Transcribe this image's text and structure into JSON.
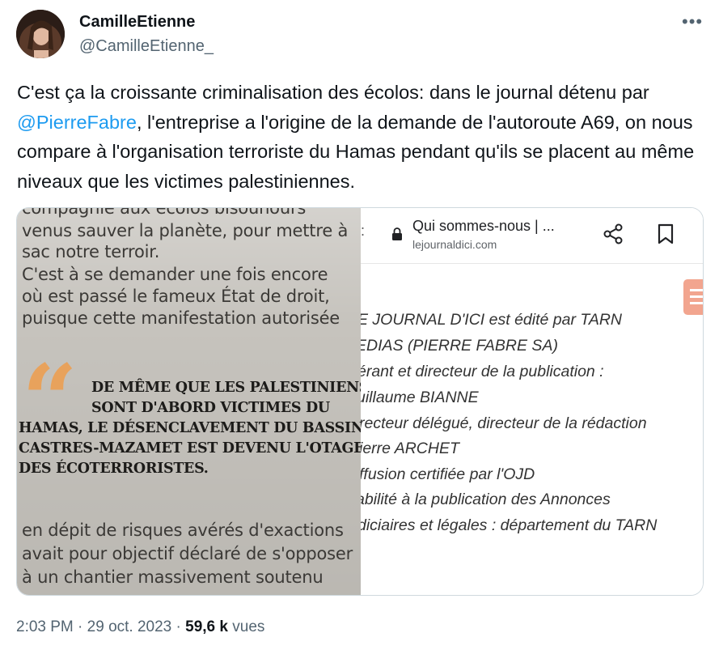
{
  "author": {
    "display_name": "CamilleEtienne",
    "handle": "@CamilleEtienne_"
  },
  "more_icon": "ellipsis-icon",
  "tweet": {
    "text_before_mention": "C'est ça la croissante criminalisation des écolos: dans le journal détenu par ",
    "mention": "@PierreFabre",
    "text_after_mention": ", l'entreprise a l'origine de la demande de l'autoroute A69, on nous compare à l'organisation terroriste du Hamas pendant qu'ils se placent au même niveaux que les victimes palestiniennes."
  },
  "media": {
    "newspaper": {
      "lines": [
        "compagnie aux écolos bisounours",
        "venus sauver la planète, pour mettre à",
        "sac notre terroir.",
        "C'est à se demander une fois encore",
        "où est passé le fameux État de droit,",
        "puisque cette manifestation autorisée"
      ],
      "quote_mark": "“",
      "quote_lines": [
        "DE MÊME QUE LES PALESTINIENS",
        "SONT D'ABORD VICTIMES DU",
        "HAMAS, LE DÉSENCLAVEMENT DU BASSIN",
        "CASTRES-MAZAMET EST DEVENU L'OTAGE",
        "DES ÉCOTERRORISTES."
      ],
      "bottom_lines": [
        "en dépit de risques avérés d'exactions",
        "avait pour objectif déclaré de s'opposer",
        "à un chantier massivement soutenu"
      ]
    },
    "browser": {
      "edge_char": ":",
      "page_title": "Qui sommes-nous | ...",
      "domain": "lejournaldici.com",
      "lines": [
        "E JOURNAL D'ICI est édité par TARN",
        "EDIAS (PIERRE FABRE SA)",
        "érant et directeur de la publication :",
        "uillaume BIANNE",
        "recteur délégué, directeur de la rédaction",
        "ierre ARCHET",
        "ffusion certifiée par l'OJD",
        "abilité à la publication des Annonces",
        "diciaires et légales : département du TARN"
      ]
    }
  },
  "meta": {
    "time": "2:03 PM",
    "date": "29 oct. 2023",
    "views_count": "59,6 k",
    "views_label": "vues"
  }
}
